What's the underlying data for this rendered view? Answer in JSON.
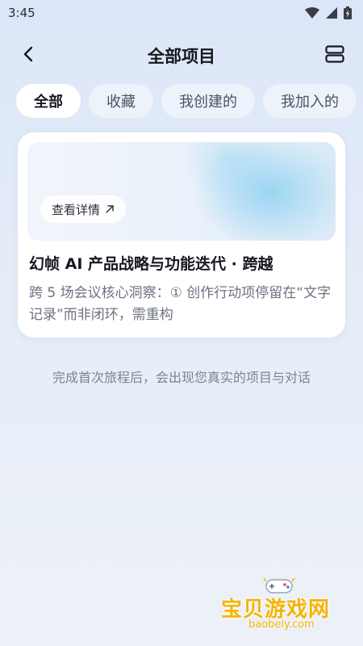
{
  "status_bar": {
    "time": "3:45"
  },
  "header": {
    "title": "全部项目"
  },
  "tabs": [
    {
      "label": "全部",
      "active": true
    },
    {
      "label": "收藏",
      "active": false
    },
    {
      "label": "我创建的",
      "active": false
    },
    {
      "label": "我加入的",
      "active": false
    }
  ],
  "project_card": {
    "detail_label": "查看详情",
    "title": "幻帧 AI 产品战略与功能迭代 · 跨越",
    "description": "跨 5 场会议核心洞察：① 创作行动项停留在“文字记录”而非闭环，需重构"
  },
  "empty_hint": "完成首次旅程后，会出现您真实的项目与对话",
  "watermark": {
    "brand": "宝贝游戏网",
    "domain": "baobeiy.com"
  },
  "colors": {
    "accent_watermark": "#f5b400",
    "background": "#dbe6f8"
  }
}
